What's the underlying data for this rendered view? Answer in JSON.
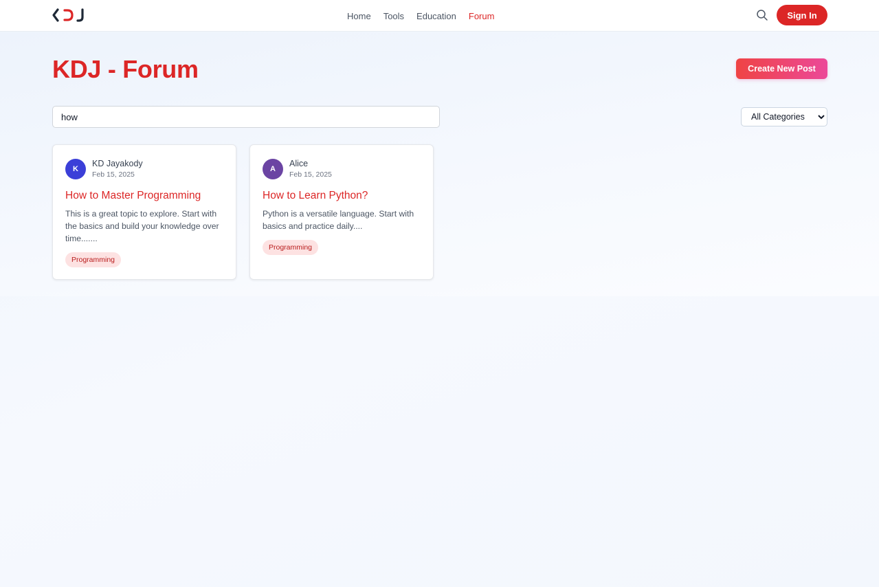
{
  "brand": {
    "logo_icon": "kdj-logo",
    "accent": "#dc2626",
    "gradient_start": "#ef4444",
    "gradient_end": "#ec4899"
  },
  "nav": {
    "items": [
      {
        "label": "Home",
        "active": false
      },
      {
        "label": "Tools",
        "active": false
      },
      {
        "label": "Education",
        "active": false
      },
      {
        "label": "Forum",
        "active": true
      }
    ]
  },
  "header": {
    "search_icon": "search-icon",
    "signin_label": "Sign In"
  },
  "page": {
    "title": "KDJ - Forum",
    "create_label": "Create New Post"
  },
  "filters": {
    "search_value": "how",
    "category_selected": "All Categories"
  },
  "posts": [
    {
      "avatar_letter": "K",
      "avatar_color": "#3b3fd8",
      "author": "KD Jayakody",
      "date": "Feb 15, 2025",
      "title": "How to Master Programming",
      "excerpt": "This is a great topic to explore. Start with the basics and build your knowledge over time.......",
      "tag": "Programming"
    },
    {
      "avatar_letter": "A",
      "avatar_color": "#6b44a3",
      "author": "Alice",
      "date": "Feb 15, 2025",
      "title": "How to Learn Python?",
      "excerpt": "Python is a versatile language. Start with basics and practice daily....",
      "tag": "Programming"
    }
  ]
}
